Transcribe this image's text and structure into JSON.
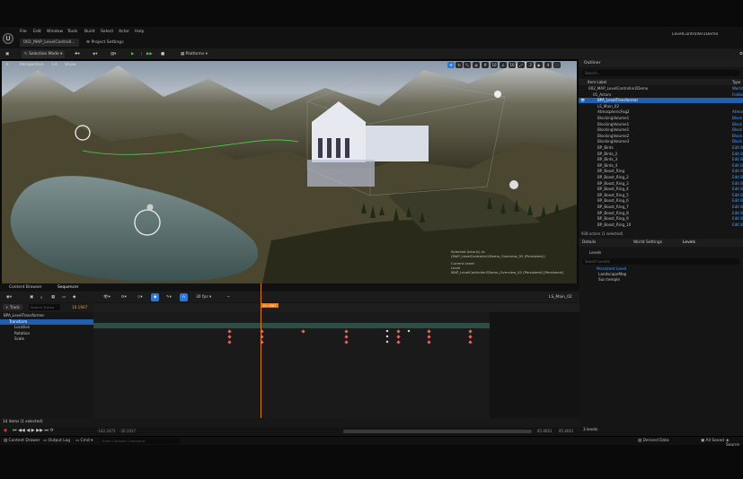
{
  "menu": [
    "File",
    "Edit",
    "Window",
    "Tools",
    "Build",
    "Select",
    "Actor",
    "Help"
  ],
  "window_title": "LevelController2Demo",
  "tabs": {
    "level": "002_MAP_LevelControll...",
    "project_settings": "Project Settings"
  },
  "toolbar": {
    "selection_mode": "Selection Mode",
    "platforms": "Platforms"
  },
  "viewport": {
    "perspective": "Perspective",
    "lit": "Lit",
    "show": "Show",
    "info_line1": "Selected Actor(s) in:",
    "info_line2": "(MAP_LevelController2Demo_Overview_02 (Persistent))",
    "info_line3": "Current Level:",
    "info_line4": "Level",
    "info_line5": "MAP_LevelController2Demo_Overview_02 (Persistent) [Persistent]"
  },
  "outliner": {
    "title": "Outliner",
    "search_placeholder": "Search...",
    "col_label": "Item Label",
    "col_type": "Type",
    "rows": [
      {
        "label": "002_MAP_LevelController2Demo",
        "type": "World",
        "indent": 1,
        "selected": false
      },
      {
        "label": "01_Actors",
        "type": "Folder",
        "indent": 2,
        "selected": false
      },
      {
        "label": "BPA_LevelTransformer",
        "type": "",
        "indent": 3,
        "selected": true
      },
      {
        "label": "LS_Main_02",
        "type": "",
        "indent": 3,
        "selected": false
      },
      {
        "label": "AtmosphericFog2",
        "type": "Atmos",
        "indent": 3,
        "selected": false
      },
      {
        "label": "BlockingVolume1",
        "type": "Block",
        "indent": 3,
        "selected": false
      },
      {
        "label": "BlockingVolume1",
        "type": "Block",
        "indent": 3,
        "selected": false
      },
      {
        "label": "BlockingVolume1",
        "type": "Block",
        "indent": 3,
        "selected": false
      },
      {
        "label": "BlockingVolume2",
        "type": "Block",
        "indent": 3,
        "selected": false
      },
      {
        "label": "BlockingVolume3",
        "type": "Block",
        "indent": 3,
        "selected": false
      },
      {
        "label": "BP_Birds",
        "type": "Edit Bl",
        "indent": 3,
        "selected": false
      },
      {
        "label": "BP_Birds_2",
        "type": "Edit Bl",
        "indent": 3,
        "selected": false
      },
      {
        "label": "BP_Birds_3",
        "type": "Edit Bl",
        "indent": 3,
        "selected": false
      },
      {
        "label": "BP_Birds_4",
        "type": "Edit Bl",
        "indent": 3,
        "selected": false
      },
      {
        "label": "BP_Boost_Ring",
        "type": "Edit Bl",
        "indent": 3,
        "selected": false
      },
      {
        "label": "BP_Boost_Ring_2",
        "type": "Edit Bl",
        "indent": 3,
        "selected": false
      },
      {
        "label": "BP_Boost_Ring_3",
        "type": "Edit Bl",
        "indent": 3,
        "selected": false
      },
      {
        "label": "BP_Boost_Ring_4",
        "type": "Edit Bl",
        "indent": 3,
        "selected": false
      },
      {
        "label": "BP_Boost_Ring_5",
        "type": "Edit Bl",
        "indent": 3,
        "selected": false
      },
      {
        "label": "BP_Boost_Ring_6",
        "type": "Edit Bl",
        "indent": 3,
        "selected": false
      },
      {
        "label": "BP_Boost_Ring_7",
        "type": "Edit Bl",
        "indent": 3,
        "selected": false
      },
      {
        "label": "BP_Boost_Ring_8",
        "type": "Edit Bl",
        "indent": 3,
        "selected": false
      },
      {
        "label": "BP_Boost_Ring_9",
        "type": "Edit Bl",
        "indent": 3,
        "selected": false
      },
      {
        "label": "BP_Boost_Ring_10",
        "type": "Edit Bl",
        "indent": 3,
        "selected": false
      }
    ],
    "footer": "938 actors (1 selected)"
  },
  "sequencer_tab": {
    "title": "Sequencer",
    "lsname": "LS_Main_02"
  },
  "details": {
    "tabs": [
      "Details",
      "World Settings",
      "Levels"
    ],
    "levels_label": "Levels",
    "search_placeholder": "Search Levels",
    "items": [
      "Persistent Level",
      "LandscapeMap",
      "Sun temple"
    ],
    "footer": "3 levels"
  },
  "sequencer": {
    "fps": "30 fps",
    "current_time": "10.1667",
    "track_button": "Track",
    "search_placeholder": "Search Tracks",
    "tracks": [
      {
        "label": "BPA_LevelTransformer",
        "level": 0
      },
      {
        "label": "Transform",
        "level": 1
      },
      {
        "label": "Location",
        "level": 2
      },
      {
        "label": "Rotation",
        "level": 2
      },
      {
        "label": "Scale",
        "level": 2
      }
    ],
    "items_count": "14 items (1 selected)",
    "time_left": "-142.2473",
    "time_left2": "-30.1937",
    "time_right": "85.8061",
    "time_right2": "85.8061"
  },
  "bottom_tabs": {
    "content_browser": "Content Browser",
    "sequencer": "Sequencer"
  },
  "statusbar": {
    "content_drawer": "Content Drawer",
    "output_log": "Output Log",
    "cmd": "Cmd",
    "cmd_placeholder": "Enter Console Command",
    "derived_data": "Derived Data",
    "all_saved": "All Saved",
    "source": "Source"
  }
}
